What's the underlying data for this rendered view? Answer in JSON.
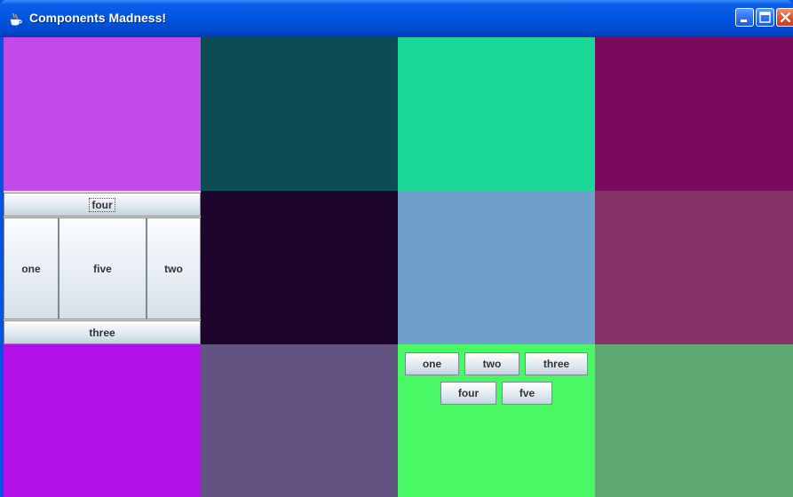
{
  "window": {
    "title": "Components Madness!",
    "app_icon": "java-cup-icon",
    "controls": {
      "minimize_icon": "minimize-icon",
      "maximize_icon": "maximize-icon",
      "close_icon": "close-icon"
    }
  },
  "colors": {
    "title_bar": "#0058e0",
    "r1c1": "#c24ae8",
    "r1c2": "#0c4d55",
    "r1c3": "#1ad896",
    "r1c4": "#7a0a5e",
    "r2c2": "#1e052b",
    "r2c3": "#6ea0cb",
    "r2c4": "#853366",
    "r3c1": "#b311ea",
    "r3c2": "#625383",
    "r3c3": "#4af866",
    "r3c4": "#5ea873"
  },
  "border_layout_panel": {
    "north": "four",
    "west": "one",
    "center": "five",
    "east": "two",
    "south": "three"
  },
  "flow_layout_panel": {
    "buttons": [
      "one",
      "two",
      "three",
      "four",
      "fve"
    ]
  }
}
